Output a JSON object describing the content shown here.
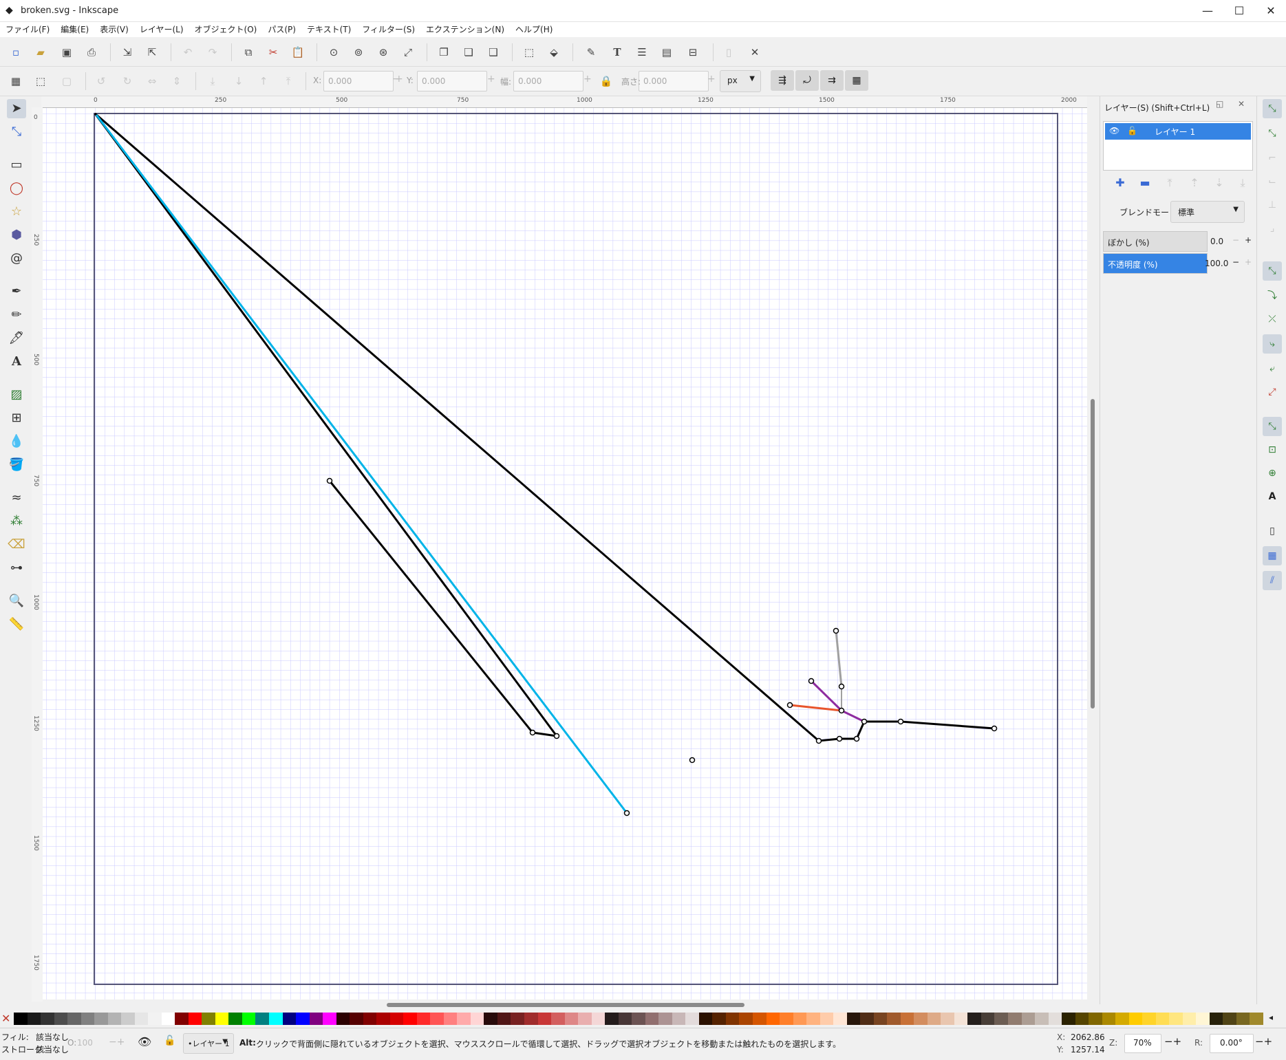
{
  "window": {
    "title": "broken.svg - Inkscape",
    "minimize": "—",
    "maximize": "☐",
    "close": "✕"
  },
  "menu": [
    "ファイル(F)",
    "編集(E)",
    "表示(V)",
    "レイヤー(L)",
    "オブジェクト(O)",
    "パス(P)",
    "テキスト(T)",
    "フィルター(S)",
    "エクステンション(N)",
    "ヘルプ(H)"
  ],
  "toolcontrols": {
    "x_label": "X:",
    "x_value": "0.000",
    "y_label": "Y:",
    "y_value": "0.000",
    "w_label": "幅:",
    "w_value": "0.000",
    "h_label": "高さ:",
    "h_value": "0.000",
    "unit": "px"
  },
  "ruler": {
    "top": [
      "0",
      "250",
      "500",
      "750",
      "1000",
      "1250",
      "1500",
      "1750",
      "2000"
    ],
    "left": [
      "0",
      "250",
      "500",
      "750",
      "1000",
      "1250",
      "1500",
      "1750"
    ]
  },
  "layers_panel": {
    "title": "レイヤー(S) (Shift+Ctrl+L)",
    "layer_name": "レイヤー 1",
    "blend_label": "ブレンドモード:",
    "blend_value": "標準",
    "blur_label": "ぼかし (%)",
    "blur_value": "0.0",
    "opacity_label": "不透明度 (%)",
    "opacity_value": "100.0",
    "opacity_percent": 100
  },
  "status": {
    "fill_label": "フィル:",
    "fill_value": "該当なし",
    "stroke_label": "ストローク:",
    "stroke_value": "該当なし",
    "o_label": "O:",
    "o_value": "100",
    "layer": "•レイヤー 1",
    "message_key": "Alt:",
    "message": " クリックで背面側に隠れているオブジェクトを選択、マウススクロールで循環して選択、ドラッグで選択オブジェクトを移動または触れたものを選択します。",
    "cursor_x_label": "X:",
    "cursor_x": "2062.86",
    "cursor_y_label": "Y:",
    "cursor_y": "1257.14",
    "zoom_label": "Z:",
    "zoom": "70%",
    "rotate_label": "R:",
    "rotate": "0.00°"
  },
  "palette": [
    "#000000",
    "#1a1a1a",
    "#333333",
    "#4d4d4d",
    "#666666",
    "#808080",
    "#999999",
    "#b3b3b3",
    "#cccccc",
    "#e6e6e6",
    "#f2f2f2",
    "#ffffff",
    "#800000",
    "#ff0000",
    "#808000",
    "#ffff00",
    "#008000",
    "#00ff00",
    "#008080",
    "#00ffff",
    "#000080",
    "#0000ff",
    "#800080",
    "#ff00ff",
    "#2b0000",
    "#550000",
    "#800000",
    "#aa0000",
    "#d40000",
    "#ff0000",
    "#ff2a2a",
    "#ff5555",
    "#ff8080",
    "#ffaaaa",
    "#ffd5d5",
    "#280b0b",
    "#501616",
    "#782121",
    "#a02c2c",
    "#c83737",
    "#d35f5f",
    "#de8787",
    "#e9afaf",
    "#f4d7d7",
    "#241c1c",
    "#483737",
    "#6c5353",
    "#916f6f",
    "#ac9393",
    "#c8b7b7",
    "#e3dbdb",
    "#2b1100",
    "#552200",
    "#803300",
    "#aa4400",
    "#d45500",
    "#ff6600",
    "#ff7f2a",
    "#ff9955",
    "#ffb380",
    "#ffccaa",
    "#ffe6d5",
    "#28170b",
    "#502d16",
    "#784421",
    "#a05a2c",
    "#c87137",
    "#d38d5f",
    "#deaa87",
    "#e9c6af",
    "#f4e3d7",
    "#241f1c",
    "#483e37",
    "#6c5d53",
    "#917c6f",
    "#ac9d93",
    "#c8beb7",
    "#e3dedb",
    "#2b2200",
    "#554400",
    "#806600",
    "#aa8800",
    "#d4aa00",
    "#ffcc00",
    "#ffd42a",
    "#ffdd55",
    "#ffe680",
    "#ffeeaa",
    "#fff6d5",
    "#28220b",
    "#504416",
    "#786721",
    "#a0892c"
  ],
  "colors": {
    "accent": "#3584e4",
    "grid": "#c8c8ff",
    "cyan_path": "#00b4e8",
    "page_border": "#555577"
  }
}
